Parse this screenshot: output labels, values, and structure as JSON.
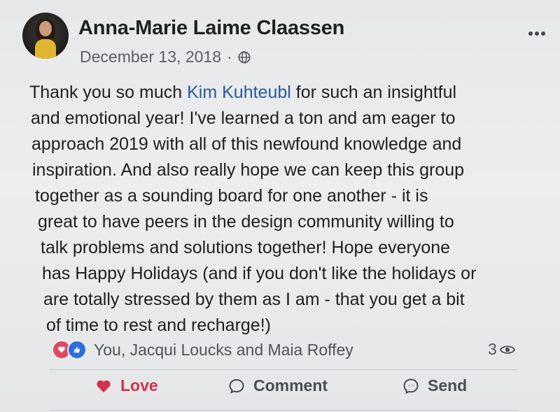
{
  "post": {
    "author": "Anna-Marie Laime Claassen",
    "date": "December 13, 2018",
    "meta_separator": "·",
    "audience_icon": "globe-icon",
    "more_icon": "more-options-icon",
    "body_lines": [
      {
        "before": "Thank you so much ",
        "mention": "Kim Kuhteubl",
        "after": " for such an insightful"
      },
      {
        "text": "and emotional year!  I've learned a ton and am eager to"
      },
      {
        "text": "approach 2019 with all of this newfound knowledge and"
      },
      {
        "text": "inspiration.  And also really hope we can keep this group"
      },
      {
        "text": "together as a sounding board for one another - it is"
      },
      {
        "text": "great to have peers in the design community willing to"
      },
      {
        "text": "talk problems and solutions together!  Hope everyone"
      },
      {
        "text": "has Happy Holidays (and if you don't like the holidays or"
      },
      {
        "text": "are totally stressed by them as I am - that you get a bit"
      },
      {
        "text": "of time to rest and recharge!)"
      }
    ]
  },
  "reactions": {
    "icons": [
      "heart-reaction-icon",
      "like-reaction-icon"
    ],
    "summary": "You, Jacqui Loucks and Maia Roffey",
    "seen_count": "3",
    "seen_icon": "eye-icon"
  },
  "actions": {
    "love_label": "Love",
    "comment_label": "Comment",
    "send_label": "Send"
  },
  "colors": {
    "mention": "#28589e",
    "love_active": "#d0334b",
    "like_blue": "#2a6fdb",
    "text": "#1e1f21",
    "secondary_text": "#5c5f63"
  }
}
